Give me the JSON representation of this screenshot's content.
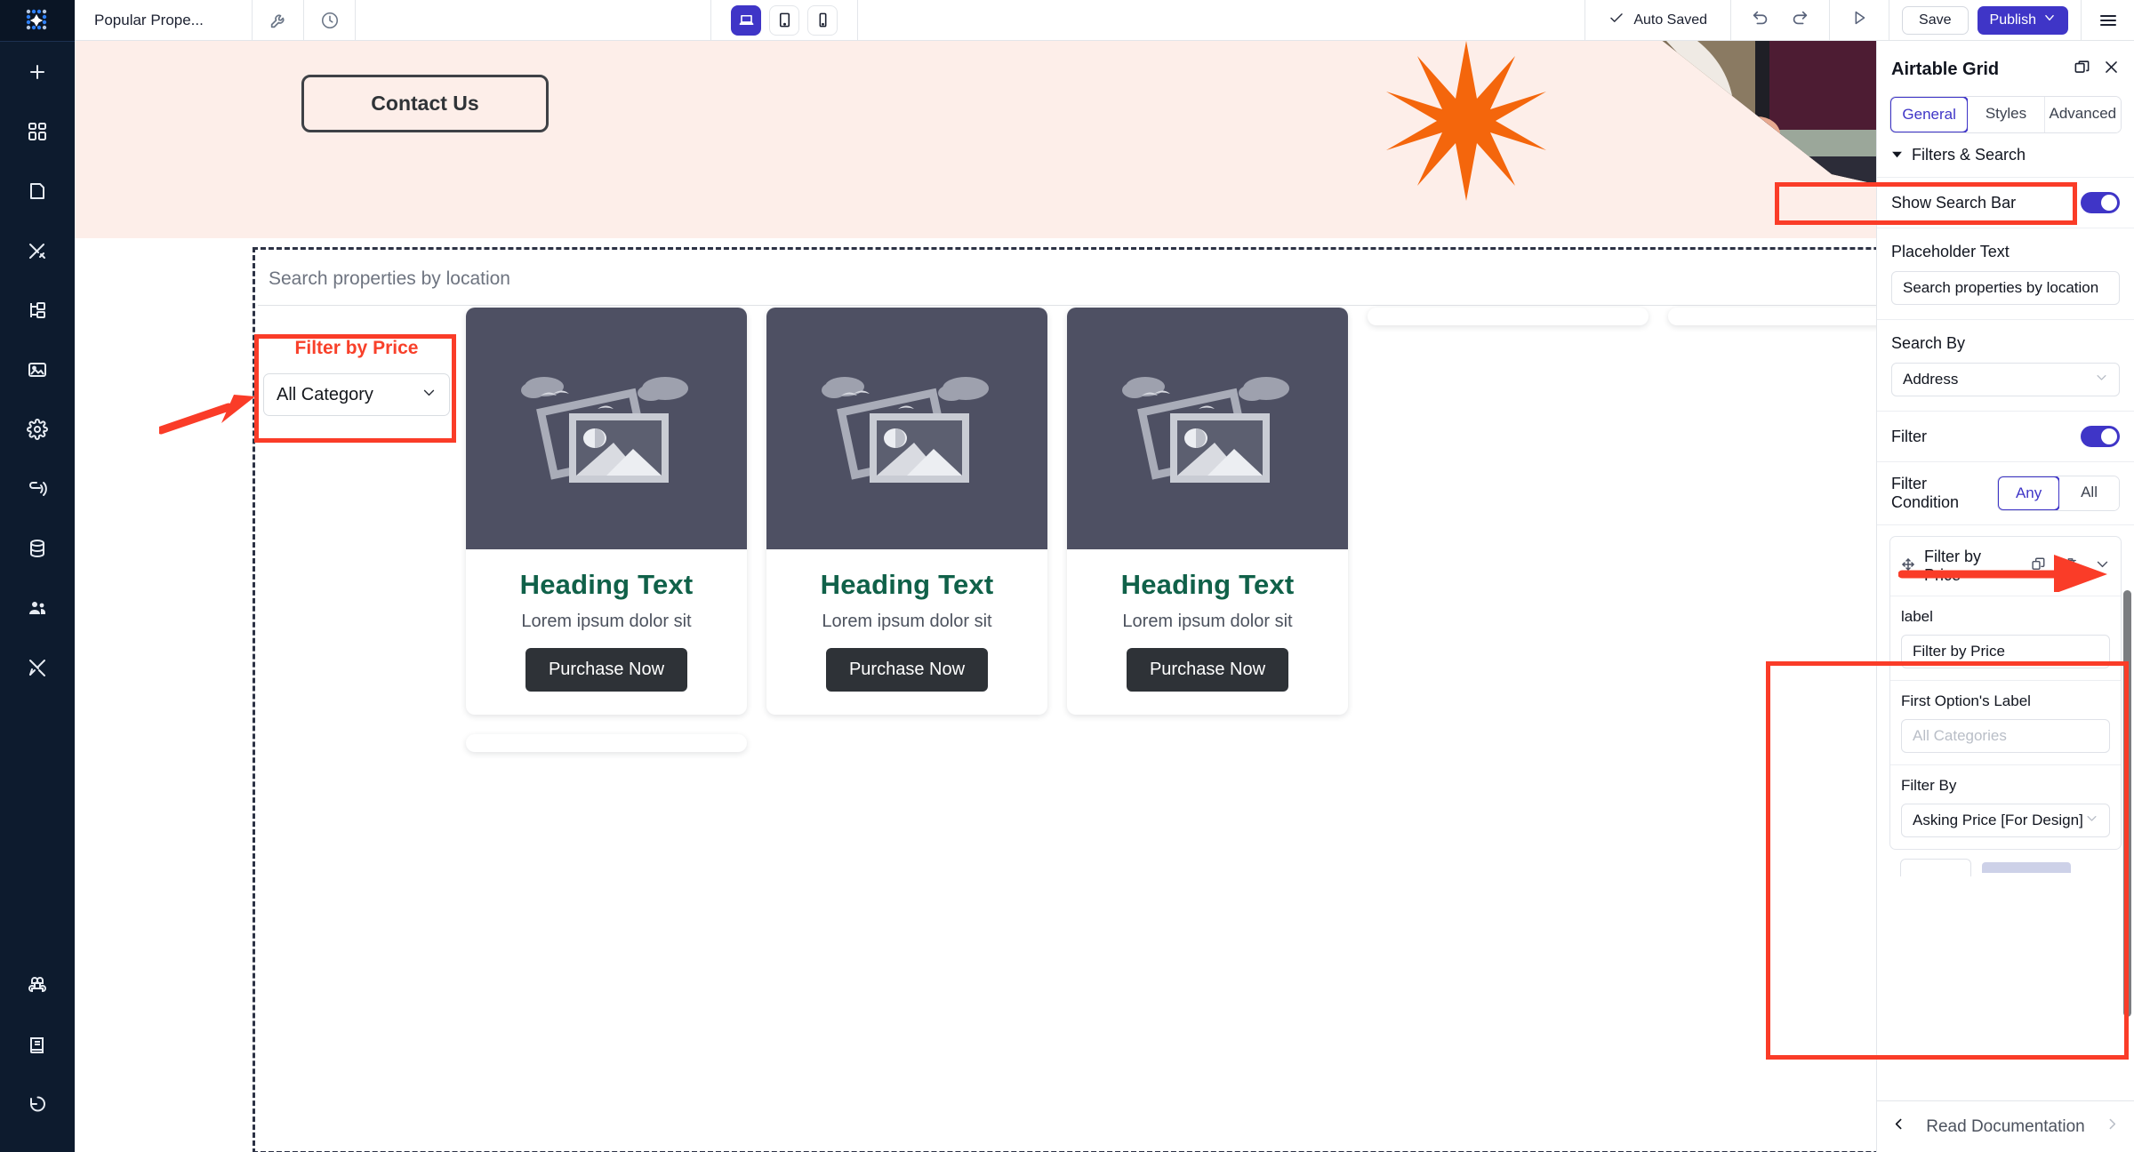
{
  "topbar": {
    "page_title": "Popular Prope...",
    "wrench_icon": "wrench-icon",
    "history_icon": "clock-icon",
    "devices": [
      {
        "name": "desktop",
        "icon": "laptop-icon",
        "active": true
      },
      {
        "name": "tablet",
        "icon": "tablet-icon",
        "active": false
      },
      {
        "name": "mobile",
        "icon": "mobile-icon",
        "active": false
      }
    ],
    "autosave_label": "Auto Saved",
    "undo_icon": "undo-icon",
    "redo_icon": "redo-icon",
    "preview_icon": "play-icon",
    "save_label": "Save",
    "publish_label": "Publish",
    "publish_chevron": "chevron-down-icon",
    "menu_icon": "hamburger-menu-icon",
    "accent_color": "#3f35c7"
  },
  "left_rail": {
    "logo_icon": "app-logo-icon",
    "items": [
      {
        "name": "add",
        "icon": "plus-icon"
      },
      {
        "name": "blocks",
        "icon": "grid-blocks-icon"
      },
      {
        "name": "pages",
        "icon": "page-icon"
      },
      {
        "name": "design",
        "icon": "pen-cross-icon"
      },
      {
        "name": "layers",
        "icon": "tree-structure-icon"
      },
      {
        "name": "media",
        "icon": "image-icon"
      },
      {
        "name": "settings",
        "icon": "gear-icon"
      },
      {
        "name": "integrations",
        "icon": "broadcast-icon"
      },
      {
        "name": "data",
        "icon": "database-icon"
      },
      {
        "name": "users",
        "icon": "users-icon"
      },
      {
        "name": "tools",
        "icon": "tools-icon"
      }
    ],
    "bottom_items": [
      {
        "name": "shortcuts",
        "icon": "command-icon"
      },
      {
        "name": "docs",
        "icon": "book-icon"
      },
      {
        "name": "history",
        "icon": "revert-clock-icon"
      }
    ]
  },
  "canvas": {
    "hero": {
      "background_color": "#fdeee9",
      "contact_button_label": "Contact Us",
      "star_icon": "orange-starburst-icon",
      "star_color": "#f4660c",
      "photo_alt": "person-with-tablet-photo"
    },
    "search": {
      "placeholder": "Search properties by location"
    },
    "filter_widget": {
      "title": "Filter by Price",
      "title_color": "#f8402a",
      "select_value": "All Category",
      "select_chevron": "chevron-down-icon"
    },
    "cards": [
      {
        "heading": "Heading Text",
        "subtitle": "Lorem ipsum dolor sit",
        "cta": "Purchase Now",
        "media_icon": "image-placeholder-icon"
      },
      {
        "heading": "Heading Text",
        "subtitle": "Lorem ipsum dolor sit",
        "cta": "Purchase Now",
        "media_icon": "image-placeholder-icon"
      },
      {
        "heading": "Heading Text",
        "subtitle": "Lorem ipsum dolor sit",
        "cta": "Purchase Now",
        "media_icon": "image-placeholder-icon"
      }
    ],
    "heading_color": "#106149"
  },
  "panel": {
    "title": "Airtable Grid",
    "detach_icon": "detach-window-icon",
    "close_icon": "close-icon",
    "tabs": [
      {
        "label": "General",
        "active": true
      },
      {
        "label": "Styles",
        "active": false
      },
      {
        "label": "Advanced",
        "active": false
      }
    ],
    "section": {
      "caret_icon": "caret-down-icon",
      "title": "Filters & Search"
    },
    "show_search_bar": {
      "label": "Show Search Bar",
      "value": "on"
    },
    "placeholder_text": {
      "label": "Placeholder Text",
      "value": "Search properties by location"
    },
    "search_by": {
      "label": "Search By",
      "value": "Address",
      "chevron": "chevron-down-icon"
    },
    "filter": {
      "label": "Filter",
      "value": "on"
    },
    "filter_condition": {
      "label": "Filter Condition",
      "options": [
        {
          "label": "Any",
          "active": true
        },
        {
          "label": "All",
          "active": false
        }
      ]
    },
    "filter_item": {
      "drag_icon": "move-handle-icon",
      "title": "Filter by Price",
      "duplicate_icon": "copy-icon",
      "delete_icon": "trash-icon",
      "collapse_icon": "chevron-down-icon",
      "label_field": {
        "label": "label",
        "value": "Filter by Price"
      },
      "first_option_field": {
        "label": "First Option's Label",
        "placeholder": "All Categories",
        "value": ""
      },
      "filter_by_field": {
        "label": "Filter By",
        "value": "Asking Price [For Design]",
        "chevron": "chevron-down-icon"
      }
    },
    "footer": {
      "prev_icon": "chevron-left-icon",
      "label": "Read Documentation",
      "next_icon": "chevron-right-icon"
    },
    "annotation_color": "#fa3c28"
  }
}
